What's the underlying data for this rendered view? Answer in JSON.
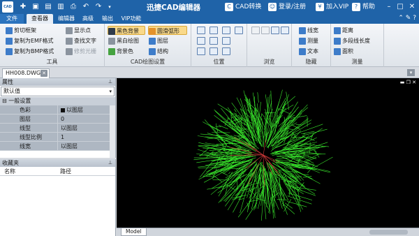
{
  "app": {
    "title": "迅捷CAD编辑器",
    "logo_text": "CAD",
    "cad_convert": "CAD转换",
    "login": "登录/注册",
    "vip": "加入VIP",
    "help": "帮助"
  },
  "menu": {
    "tabs": [
      "文件",
      "查看器",
      "编辑器",
      "高级",
      "输出",
      "VIP功能"
    ]
  },
  "ribbon": {
    "tools": {
      "label": "工具",
      "items": [
        "剪切框架",
        "复制为EMF格式",
        "复制为BMP格式",
        "显示点",
        "查找文字",
        "修剪光栅"
      ]
    },
    "display": {
      "label": "CAD绘图设置",
      "items": [
        "黑色背景",
        "黑白绘图",
        "背景色",
        "圆滑弧形",
        "图层",
        "结构"
      ]
    },
    "position": {
      "label": "位置"
    },
    "browse": {
      "label": "浏览"
    },
    "hide": {
      "label": "隐藏",
      "items": [
        "线宽",
        "测量",
        "文本"
      ]
    },
    "measure": {
      "label": "测量",
      "items": [
        "距离",
        "多段线长度",
        "面积"
      ]
    }
  },
  "doc_tab": {
    "name": "HH008.DWG"
  },
  "properties": {
    "title": "属性",
    "selector": "默认值",
    "section": "一般设置",
    "rows": [
      {
        "key": "色彩",
        "value": "以图层"
      },
      {
        "key": "图层",
        "value": "0"
      },
      {
        "key": "线型",
        "value": "以图层"
      },
      {
        "key": "线型比例",
        "value": "1"
      },
      {
        "key": "线宽",
        "value": "以图层"
      }
    ]
  },
  "favorites": {
    "title": "收藏夹",
    "col_name": "名称",
    "col_path": "路径"
  },
  "canvas": {
    "model_tab": "Model",
    "background": "#000000",
    "drawing_color": "#39e62c",
    "accent_color": "#d23a3a"
  },
  "colors": {
    "title_bar": "#1f63a8",
    "ribbon_selected": "#f9d98a"
  }
}
